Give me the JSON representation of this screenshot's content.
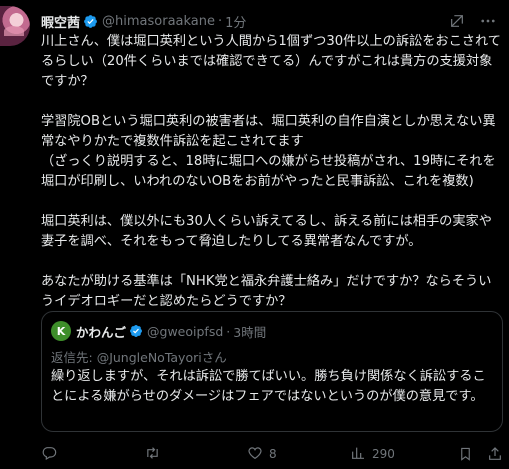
{
  "author": {
    "name": "暇空茜",
    "handle": "@himasoraakane",
    "time": "1分"
  },
  "icons": {
    "avatar": "avatar",
    "verified": "verified-badge-icon",
    "grok": "grok-icon",
    "more": "more-options-icon",
    "reply": "reply-icon",
    "retweet": "retweet-icon",
    "like": "like-icon",
    "views": "views-icon",
    "bookmark": "bookmark-icon",
    "share": "share-icon"
  },
  "colors": {
    "background": "#000000",
    "text": "#e7e9ea",
    "muted": "#71767b",
    "verified": "#1d9bf0",
    "border": "#2f3336",
    "quote_avatar": "#3e8e2a"
  },
  "tweet": {
    "text": "川上さん、僕は堀口英利という人間から1個ずつ30件以上の訴訟をおこされてるらしい（20件くらいまでは確認できてる）んですがこれは貴方の支援対象ですか？\n\n学習院OBという堀口英利の被害者は、堀口英利の自作自演としか思えない異常なやりかたで複数件訴訟を起こされてます\n（ざっくり説明すると、18時に堀口への嫌がらせ投稿がされ、19時にそれを堀口が印刷し、いわれのないOBをお前がやったと民事訴訟、これを複数)\n\n堀口英利は、僕以外にも30人くらい訴えてるし、訴える前には相手の実家や妻子を調べ、それをもって脅迫したりしてる異常者なんですが。\n\nあなたが助ける基準は「NHK党と福永弁護士絡み」だけですか？ならそういうイデオロギーだと認めたらどうですか？"
  },
  "quote": {
    "avatar_letter": "K",
    "name": "かわんご",
    "handle": "@gweoipfsd",
    "time": "3時間",
    "reply_label": "返信先: ",
    "reply_to": "@JungleNoTayoriさん",
    "text": "繰り返しますが、それは訴訟で勝てばいい。勝ち負け関係なく訴訟することによる嫌がらせのダメージはフェアではないというのが僕の意見です。"
  },
  "stats": {
    "replies": "",
    "retweets": "",
    "likes": "8",
    "views": "290"
  }
}
